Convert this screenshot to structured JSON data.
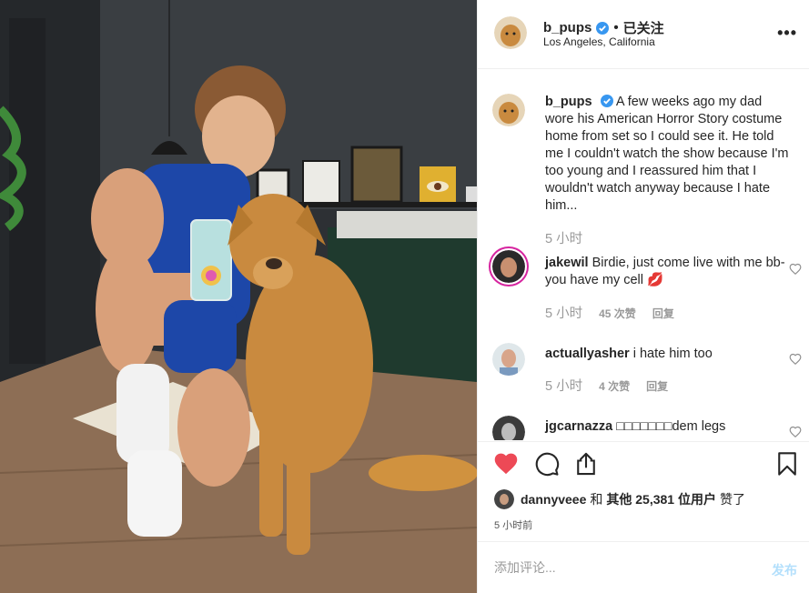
{
  "post": {
    "username": "b_pups",
    "follow_state": "已关注",
    "location": "Los Angeles, California",
    "more_label": "•••"
  },
  "comments": [
    {
      "username": "b_pups",
      "text": "A few weeks ago my dad wore his American Horror Story costume home from set so I could see it. He told me I couldn't watch the show because I'm too young and I reassured him that I wouldn't watch anyway because I hate him...",
      "time": "5 小时"
    },
    {
      "username": "jakewil",
      "text": "Birdie, just come live with me bb- you have my cell 💋",
      "time": "5 小时",
      "likes": "45 次赞",
      "reply": "回复"
    },
    {
      "username": "actuallyasher",
      "text": "i hate him too",
      "time": "5 小时",
      "likes": "4 次赞",
      "reply": "回复"
    },
    {
      "username": "jgcarnazza",
      "text": "□□□□□□□dem legs"
    }
  ],
  "likes": {
    "user": "dannyveee",
    "connector": "和",
    "others": "其他 25,381 位用户",
    "suffix": "赞了"
  },
  "timestamp": "5 小时前",
  "add_comment": {
    "placeholder": "添加评论...",
    "post_label": "发布"
  },
  "colors": {
    "like_red": "#ed4956",
    "verified_blue": "#3897f0",
    "post_disabled": "#b2dffc"
  }
}
